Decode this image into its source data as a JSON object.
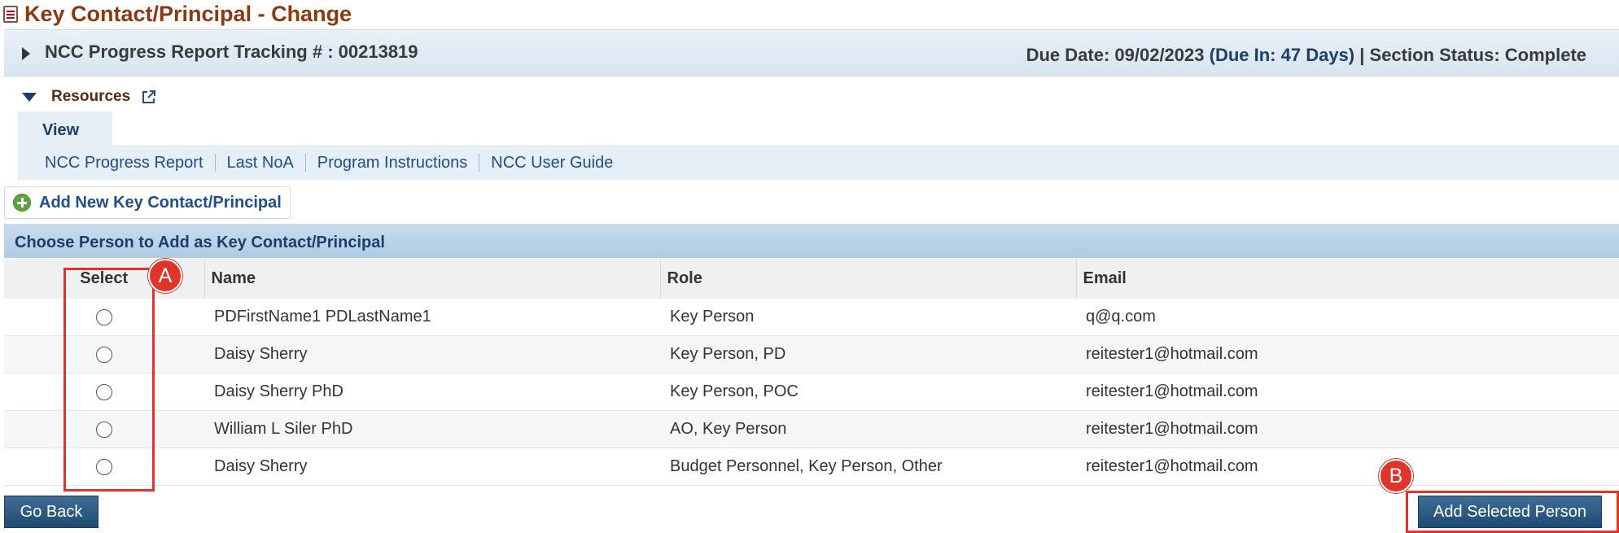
{
  "page": {
    "title": "Key Contact/Principal - Change"
  },
  "tracking": {
    "title": "NCC Progress Report Tracking # : 00213819",
    "due_date": "Due Date: 09/02/2023",
    "due_in": "(Due In: 47 Days)",
    "section_status": "| Section Status: Complete"
  },
  "resources": {
    "label": "Resources",
    "view_tab": "View",
    "links": [
      "NCC Progress Report",
      "Last NoA",
      "Program Instructions",
      "NCC User Guide"
    ]
  },
  "add_new_label": "Add New Key Contact/Principal",
  "section_title": "Choose Person to Add as Key Contact/Principal",
  "table": {
    "columns": [
      "Select",
      "Name",
      "Role",
      "Email"
    ],
    "rows": [
      {
        "name": "PDFirstName1 PDLastName1",
        "role": "Key Person",
        "email": "q@q.com"
      },
      {
        "name": "Daisy Sherry",
        "role": "Key Person, PD",
        "email": "reitester1@hotmail.com"
      },
      {
        "name": "Daisy Sherry PhD",
        "role": "Key Person, POC",
        "email": "reitester1@hotmail.com"
      },
      {
        "name": "William L Siler PhD",
        "role": "AO, Key Person",
        "email": "reitester1@hotmail.com"
      },
      {
        "name": "Daisy Sherry",
        "role": "Budget Personnel, Key Person, Other",
        "email": "reitester1@hotmail.com"
      }
    ]
  },
  "buttons": {
    "go_back": "Go Back",
    "add_selected": "Add Selected Person"
  },
  "annotations": {
    "a": "A",
    "b": "B"
  }
}
